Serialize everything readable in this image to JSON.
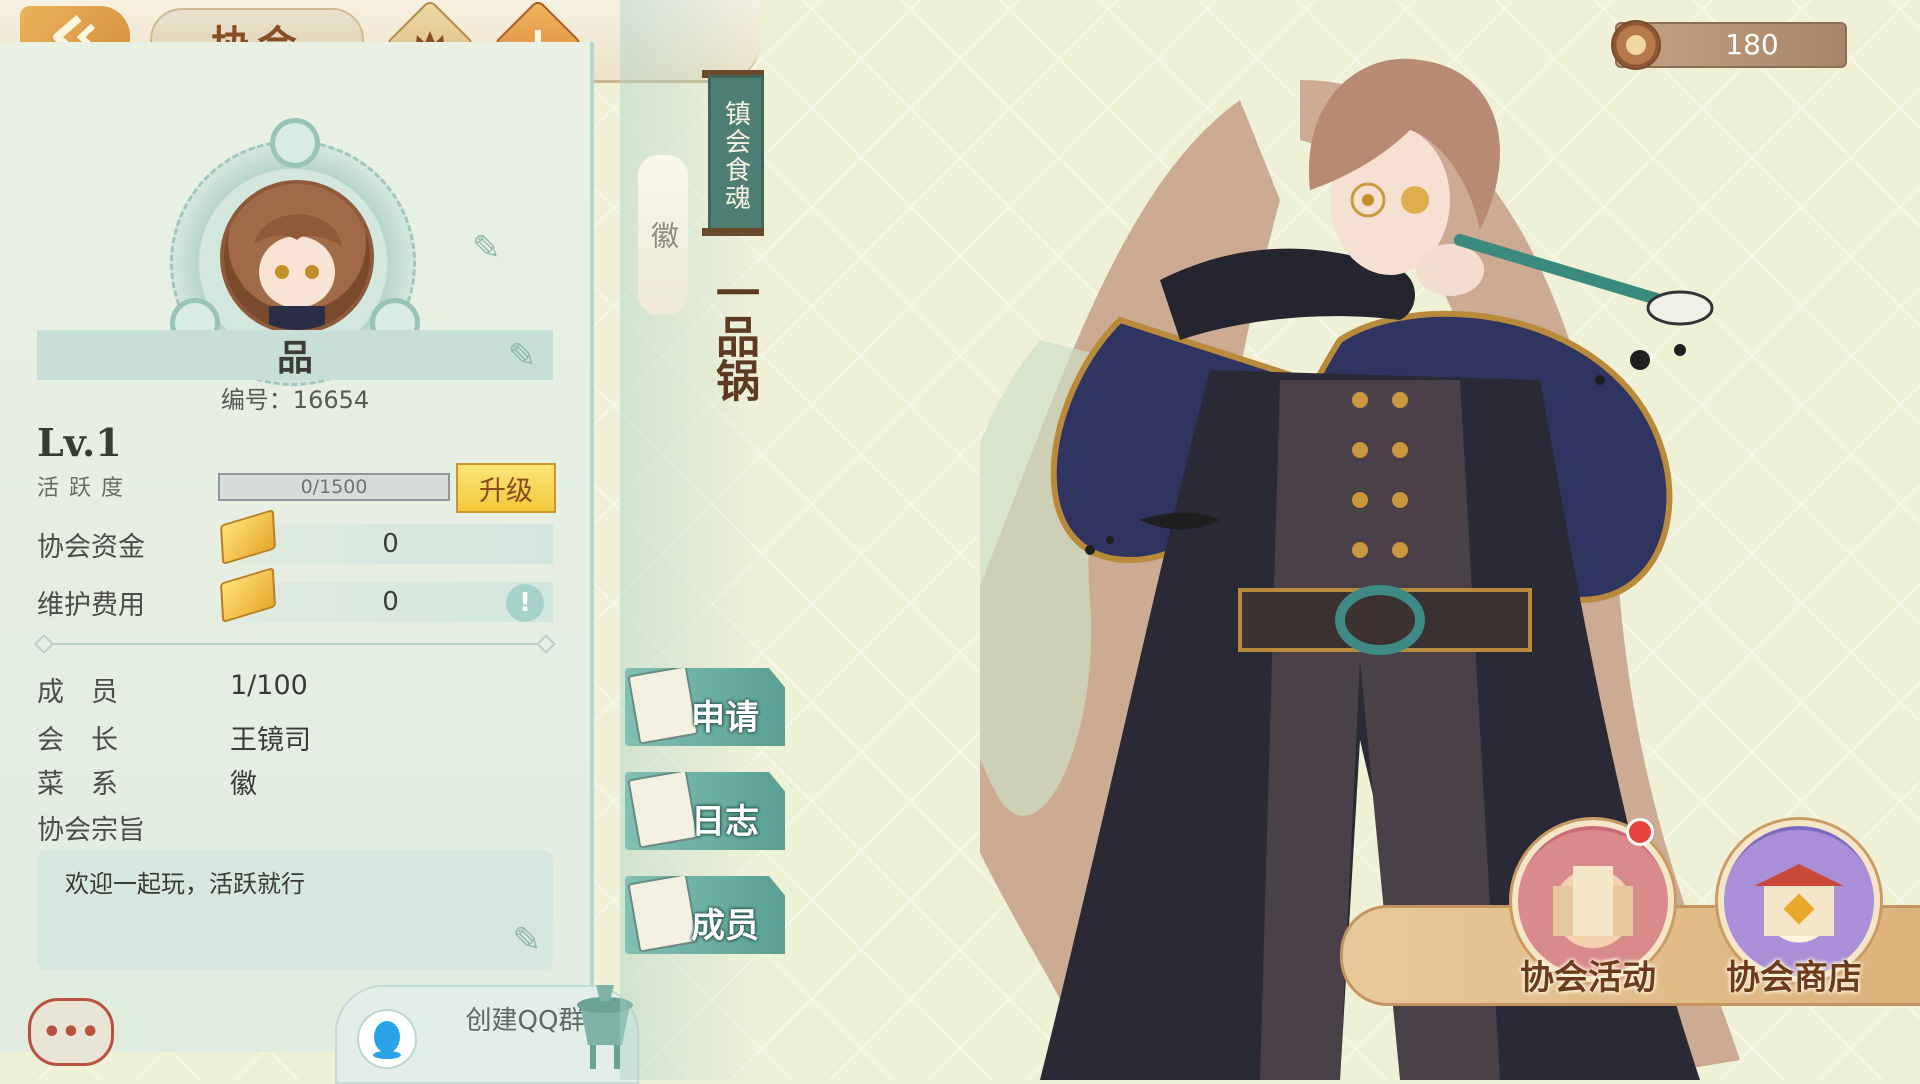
{
  "header": {
    "title": "协会",
    "back_icon": "back-arrow-icon",
    "crown_icon": "crown-icon",
    "alert_icon": "alert-icon",
    "alert_glyph": "!"
  },
  "currency": {
    "icon": "coin-icon",
    "value": "180"
  },
  "profile": {
    "name": "品",
    "id_text": "编号：16654",
    "level": "Lv.1",
    "activity_label": "活跃度",
    "activity_progress": "0/1500",
    "activity_fraction": 0,
    "upgrade_label": "升级",
    "fund_label": "协会资金",
    "fund_value": "0",
    "maintenance_label": "维护费用",
    "maintenance_value": "0",
    "maintenance_alert": "!"
  },
  "info": {
    "members_key": "成　员",
    "members_value": "1/100",
    "leader_key": "会　长",
    "leader_value": "王镜司",
    "cuisine_key": "菜　系",
    "cuisine_value": "徽",
    "motto_key": "协会宗旨",
    "motto_value": "欢迎一起玩，活跃就行"
  },
  "banner": {
    "guardian_label": "镇会食魂",
    "cuisine_tag": "徽",
    "pot_name": "一品锅"
  },
  "side_buttons": [
    {
      "label": "申请",
      "icon": "letter-icon"
    },
    {
      "label": "日志",
      "icon": "book-icon"
    },
    {
      "label": "成员",
      "icon": "handshake-icon"
    }
  ],
  "bottom": {
    "chat_glyph": "•••",
    "qq_label": "创建QQ群",
    "activity_button": "协会活动",
    "shop_button": "协会商店"
  },
  "colors": {
    "panel": "#e6eee5",
    "accent_teal": "#5a9f93",
    "accent_gold": "#f2c93c",
    "title_brown": "#8b4e24"
  }
}
